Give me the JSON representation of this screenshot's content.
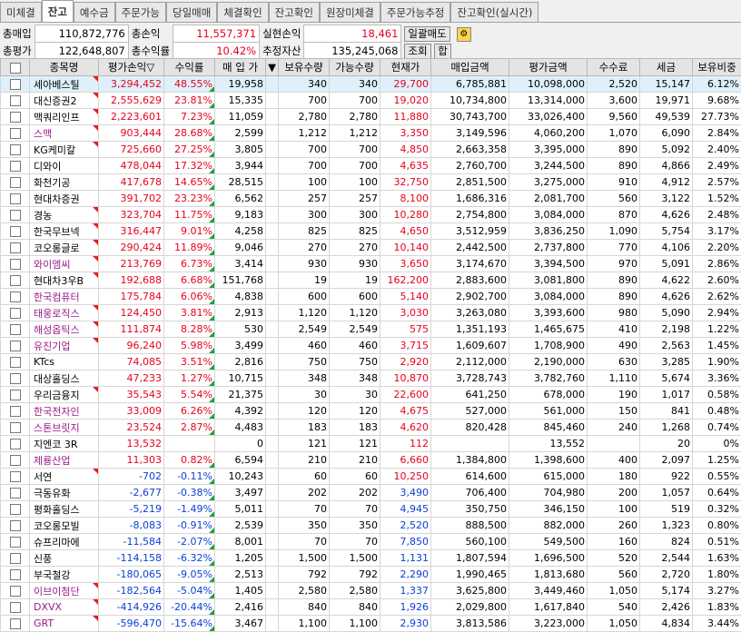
{
  "tabs": [
    "미체결",
    "잔고",
    "예수금",
    "주문가능",
    "당일매매",
    "체결확인",
    "잔고확인",
    "원장미체결",
    "주문가능추정",
    "잔고확인(실시간)"
  ],
  "active_tab": 1,
  "summary": {
    "total_buy_label": "총매입",
    "total_buy": "110,872,776",
    "total_loss_label": "총손익",
    "total_loss": "11,557,371",
    "realized_label": "실현손익",
    "realized": "18,461",
    "bulk_sell": "일괄매도",
    "total_eval_label": "총평가",
    "total_eval": "122,648,807",
    "total_rate_label": "총수익률",
    "total_rate": "10.42%",
    "est_asset_label": "추정자산",
    "est_asset": "135,245,068",
    "query_button": "조회",
    "sum_button": "합"
  },
  "columns": [
    "",
    "종목명",
    "평가손익▽",
    "수익률",
    "매 입 가",
    "▼",
    "보유수량",
    "가능수량",
    "현재가",
    "매입금액",
    "평가금액",
    "수수료",
    "세금",
    "보유비중"
  ],
  "rows": [
    {
      "name": "세아베스틸",
      "pl": "3,294,452",
      "rate": "48.55%",
      "buy": "19,958",
      "hold": "340",
      "avail": "340",
      "cur": "29,700",
      "buyamt": "6,785,881",
      "evalamt": "10,098,000",
      "fee": "2,520",
      "tax": "15,147",
      "weight": "6.12%",
      "up": true,
      "purple": false
    },
    {
      "name": "대신증권2",
      "pl": "2,555,629",
      "rate": "23.81%",
      "buy": "15,335",
      "hold": "700",
      "avail": "700",
      "cur": "19,020",
      "buyamt": "10,734,800",
      "evalamt": "13,314,000",
      "fee": "3,600",
      "tax": "19,971",
      "weight": "9.68%",
      "up": true,
      "purple": false
    },
    {
      "name": "맥쿼리인프",
      "pl": "2,223,601",
      "rate": "7.23%",
      "buy": "11,059",
      "hold": "2,780",
      "avail": "2,780",
      "cur": "11,880",
      "buyamt": "30,743,700",
      "evalamt": "33,026,400",
      "fee": "9,560",
      "tax": "49,539",
      "weight": "27.73%",
      "up": true,
      "purple": false
    },
    {
      "name": "스맥",
      "pl": "903,444",
      "rate": "28.68%",
      "buy": "2,599",
      "hold": "1,212",
      "avail": "1,212",
      "cur": "3,350",
      "buyamt": "3,149,596",
      "evalamt": "4,060,200",
      "fee": "1,070",
      "tax": "6,090",
      "weight": "2.84%",
      "up": true,
      "purple": true
    },
    {
      "name": "KG케미칼",
      "pl": "725,660",
      "rate": "27.25%",
      "buy": "3,805",
      "hold": "700",
      "avail": "700",
      "cur": "4,850",
      "buyamt": "2,663,358",
      "evalamt": "3,395,000",
      "fee": "890",
      "tax": "5,092",
      "weight": "2.40%",
      "up": true,
      "purple": false
    },
    {
      "name": "디와이",
      "pl": "478,044",
      "rate": "17.32%",
      "buy": "3,944",
      "hold": "700",
      "avail": "700",
      "cur": "4,635",
      "buyamt": "2,760,700",
      "evalamt": "3,244,500",
      "fee": "890",
      "tax": "4,866",
      "weight": "2.49%",
      "up": false,
      "purple": false
    },
    {
      "name": "화천기공",
      "pl": "417,678",
      "rate": "14.65%",
      "buy": "28,515",
      "hold": "100",
      "avail": "100",
      "cur": "32,750",
      "buyamt": "2,851,500",
      "evalamt": "3,275,000",
      "fee": "910",
      "tax": "4,912",
      "weight": "2.57%",
      "up": false,
      "purple": false
    },
    {
      "name": "현대차증권",
      "pl": "391,702",
      "rate": "23.23%",
      "buy": "6,562",
      "hold": "257",
      "avail": "257",
      "cur": "8,100",
      "buyamt": "1,686,316",
      "evalamt": "2,081,700",
      "fee": "560",
      "tax": "3,122",
      "weight": "1.52%",
      "up": false,
      "purple": false
    },
    {
      "name": "경농",
      "pl": "323,704",
      "rate": "11.75%",
      "buy": "9,183",
      "hold": "300",
      "avail": "300",
      "cur": "10,280",
      "buyamt": "2,754,800",
      "evalamt": "3,084,000",
      "fee": "870",
      "tax": "4,626",
      "weight": "2.48%",
      "up": true,
      "purple": false
    },
    {
      "name": "한국무브넥",
      "pl": "316,447",
      "rate": "9.01%",
      "buy": "4,258",
      "hold": "825",
      "avail": "825",
      "cur": "4,650",
      "buyamt": "3,512,959",
      "evalamt": "3,836,250",
      "fee": "1,090",
      "tax": "5,754",
      "weight": "3.17%",
      "up": true,
      "purple": false
    },
    {
      "name": "코오롱글로",
      "pl": "290,424",
      "rate": "11.89%",
      "buy": "9,046",
      "hold": "270",
      "avail": "270",
      "cur": "10,140",
      "buyamt": "2,442,500",
      "evalamt": "2,737,800",
      "fee": "770",
      "tax": "4,106",
      "weight": "2.20%",
      "up": true,
      "purple": false
    },
    {
      "name": "와이엠씨",
      "pl": "213,769",
      "rate": "6.73%",
      "buy": "3,414",
      "hold": "930",
      "avail": "930",
      "cur": "3,650",
      "buyamt": "3,174,670",
      "evalamt": "3,394,500",
      "fee": "970",
      "tax": "5,091",
      "weight": "2.86%",
      "up": true,
      "purple": true
    },
    {
      "name": "현대차3우B",
      "pl": "192,688",
      "rate": "6.68%",
      "buy": "151,768",
      "hold": "19",
      "avail": "19",
      "cur": "162,200",
      "buyamt": "2,883,600",
      "evalamt": "3,081,800",
      "fee": "890",
      "tax": "4,622",
      "weight": "2.60%",
      "up": true,
      "purple": false
    },
    {
      "name": "한국컴퓨터",
      "pl": "175,784",
      "rate": "6.06%",
      "buy": "4,838",
      "hold": "600",
      "avail": "600",
      "cur": "5,140",
      "buyamt": "2,902,700",
      "evalamt": "3,084,000",
      "fee": "890",
      "tax": "4,626",
      "weight": "2.62%",
      "up": false,
      "purple": true
    },
    {
      "name": "태웅로직스",
      "pl": "124,450",
      "rate": "3.81%",
      "buy": "2,913",
      "hold": "1,120",
      "avail": "1,120",
      "cur": "3,030",
      "buyamt": "3,263,080",
      "evalamt": "3,393,600",
      "fee": "980",
      "tax": "5,090",
      "weight": "2.94%",
      "up": true,
      "purple": true
    },
    {
      "name": "해성옵틱스",
      "pl": "111,874",
      "rate": "8.28%",
      "buy": "530",
      "hold": "2,549",
      "avail": "2,549",
      "cur": "575",
      "buyamt": "1,351,193",
      "evalamt": "1,465,675",
      "fee": "410",
      "tax": "2,198",
      "weight": "1.22%",
      "up": true,
      "purple": true
    },
    {
      "name": "유진기업",
      "pl": "96,240",
      "rate": "5.98%",
      "buy": "3,499",
      "hold": "460",
      "avail": "460",
      "cur": "3,715",
      "buyamt": "1,609,607",
      "evalamt": "1,708,900",
      "fee": "490",
      "tax": "2,563",
      "weight": "1.45%",
      "up": true,
      "purple": true
    },
    {
      "name": "KTcs",
      "pl": "74,085",
      "rate": "3.51%",
      "buy": "2,816",
      "hold": "750",
      "avail": "750",
      "cur": "2,920",
      "buyamt": "2,112,000",
      "evalamt": "2,190,000",
      "fee": "630",
      "tax": "3,285",
      "weight": "1.90%",
      "up": false,
      "purple": false
    },
    {
      "name": "대상홀딩스",
      "pl": "47,233",
      "rate": "1.27%",
      "buy": "10,715",
      "hold": "348",
      "avail": "348",
      "cur": "10,870",
      "buyamt": "3,728,743",
      "evalamt": "3,782,760",
      "fee": "1,110",
      "tax": "5,674",
      "weight": "3.36%",
      "up": false,
      "purple": false
    },
    {
      "name": "우리금융지",
      "pl": "35,543",
      "rate": "5.54%",
      "buy": "21,375",
      "hold": "30",
      "avail": "30",
      "cur": "22,600",
      "buyamt": "641,250",
      "evalamt": "678,000",
      "fee": "190",
      "tax": "1,017",
      "weight": "0.58%",
      "up": true,
      "purple": false
    },
    {
      "name": "한국전자인",
      "pl": "33,009",
      "rate": "6.26%",
      "buy": "4,392",
      "hold": "120",
      "avail": "120",
      "cur": "4,675",
      "buyamt": "527,000",
      "evalamt": "561,000",
      "fee": "150",
      "tax": "841",
      "weight": "0.48%",
      "up": false,
      "purple": true
    },
    {
      "name": "스톤브릿지",
      "pl": "23,524",
      "rate": "2.87%",
      "buy": "4,483",
      "hold": "183",
      "avail": "183",
      "cur": "4,620",
      "buyamt": "820,428",
      "evalamt": "845,460",
      "fee": "240",
      "tax": "1,268",
      "weight": "0.74%",
      "up": false,
      "purple": true
    },
    {
      "name": "지엔코 3R",
      "pl": "13,532",
      "rate": "",
      "buy": "0",
      "hold": "121",
      "avail": "121",
      "cur": "112",
      "buyamt": "",
      "evalamt": "13,552",
      "fee": "",
      "tax": "20",
      "weight": "0%",
      "up": false,
      "purple": false
    },
    {
      "name": "제룡산업",
      "pl": "11,303",
      "rate": "0.82%",
      "buy": "6,594",
      "hold": "210",
      "avail": "210",
      "cur": "6,660",
      "buyamt": "1,384,800",
      "evalamt": "1,398,600",
      "fee": "400",
      "tax": "2,097",
      "weight": "1.25%",
      "up": false,
      "purple": true
    },
    {
      "name": "서연",
      "pl": "-702",
      "rate": "-0.11%",
      "buy": "10,243",
      "hold": "60",
      "avail": "60",
      "cur": "10,250",
      "buyamt": "614,600",
      "evalamt": "615,000",
      "fee": "180",
      "tax": "922",
      "weight": "0.55%",
      "up": true,
      "purple": false
    },
    {
      "name": "극동유화",
      "pl": "-2,677",
      "rate": "-0.38%",
      "buy": "3,497",
      "hold": "202",
      "avail": "202",
      "cur": "3,490",
      "buyamt": "706,400",
      "evalamt": "704,980",
      "fee": "200",
      "tax": "1,057",
      "weight": "0.64%",
      "up": false,
      "purple": false
    },
    {
      "name": "평화홀딩스",
      "pl": "-5,219",
      "rate": "-1.49%",
      "buy": "5,011",
      "hold": "70",
      "avail": "70",
      "cur": "4,945",
      "buyamt": "350,750",
      "evalamt": "346,150",
      "fee": "100",
      "tax": "519",
      "weight": "0.32%",
      "up": false,
      "purple": false
    },
    {
      "name": "코오롱모빌",
      "pl": "-8,083",
      "rate": "-0.91%",
      "buy": "2,539",
      "hold": "350",
      "avail": "350",
      "cur": "2,520",
      "buyamt": "888,500",
      "evalamt": "882,000",
      "fee": "260",
      "tax": "1,323",
      "weight": "0.80%",
      "up": false,
      "purple": false
    },
    {
      "name": "슈프리마에",
      "pl": "-11,584",
      "rate": "-2.07%",
      "buy": "8,001",
      "hold": "70",
      "avail": "70",
      "cur": "7,850",
      "buyamt": "560,100",
      "evalamt": "549,500",
      "fee": "160",
      "tax": "824",
      "weight": "0.51%",
      "up": false,
      "purple": false
    },
    {
      "name": "신풍",
      "pl": "-114,158",
      "rate": "-6.32%",
      "buy": "1,205",
      "hold": "1,500",
      "avail": "1,500",
      "cur": "1,131",
      "buyamt": "1,807,594",
      "evalamt": "1,696,500",
      "fee": "520",
      "tax": "2,544",
      "weight": "1.63%",
      "up": false,
      "purple": false
    },
    {
      "name": "부국철강",
      "pl": "-180,065",
      "rate": "-9.05%",
      "buy": "2,513",
      "hold": "792",
      "avail": "792",
      "cur": "2,290",
      "buyamt": "1,990,465",
      "evalamt": "1,813,680",
      "fee": "560",
      "tax": "2,720",
      "weight": "1.80%",
      "up": false,
      "purple": false
    },
    {
      "name": "이브이첨단",
      "pl": "-182,564",
      "rate": "-5.04%",
      "buy": "1,405",
      "hold": "2,580",
      "avail": "2,580",
      "cur": "1,337",
      "buyamt": "3,625,800",
      "evalamt": "3,449,460",
      "fee": "1,050",
      "tax": "5,174",
      "weight": "3.27%",
      "up": true,
      "purple": true
    },
    {
      "name": "DXVX",
      "pl": "-414,926",
      "rate": "-20.44%",
      "buy": "2,416",
      "hold": "840",
      "avail": "840",
      "cur": "1,926",
      "buyamt": "2,029,800",
      "evalamt": "1,617,840",
      "fee": "540",
      "tax": "2,426",
      "weight": "1.83%",
      "up": true,
      "purple": true
    },
    {
      "name": "GRT",
      "pl": "-596,470",
      "rate": "-15.64%",
      "buy": "3,467",
      "hold": "1,100",
      "avail": "1,100",
      "cur": "2,930",
      "buyamt": "3,813,586",
      "evalamt": "3,223,000",
      "fee": "1,050",
      "tax": "4,834",
      "weight": "3.44%",
      "up": true,
      "purple": true
    }
  ],
  "colors": {
    "profit": "#e8001c",
    "loss": "#0a3fd6",
    "name_purple": "#9a1a8a",
    "selected_row": "#dff0fa"
  }
}
